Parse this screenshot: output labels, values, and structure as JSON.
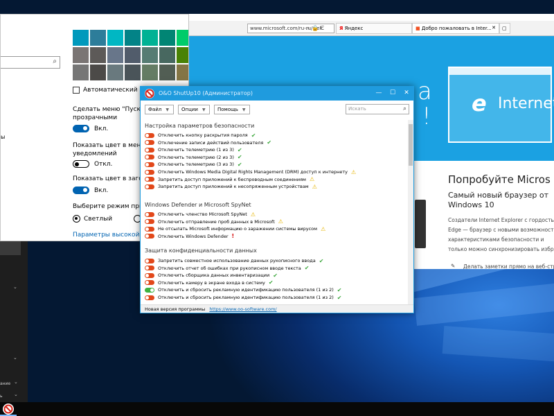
{
  "settings": {
    "auto_color_label": "Автоматический выбо",
    "start_transparent_line1": "Сделать меню \"Пуск\", пан",
    "start_transparent_line2": "прозрачными",
    "toggle1_state": "Вкл.",
    "show_color_start_line1": "Показать цвет в меню \"Пу",
    "show_color_start_line2": "уведомлений",
    "toggle2_state": "Откл.",
    "show_color_title": "Показать цвет в заголовк",
    "toggle3_state": "Вкл.",
    "app_mode_label": "Выберите режим приложе",
    "radio_light": "Светлый",
    "high_contrast_link": "Параметры высокой конт",
    "left_cut_label": "ы",
    "swatches": [
      "#0099bc",
      "#2d7d9a",
      "#00b7c3",
      "#038387",
      "#00b294",
      "#018574",
      "#00cc6a",
      "#10893e",
      "#7a7574",
      "#5d5a58",
      "#68768a",
      "#515c6b",
      "#567c73",
      "#486860",
      "#498205",
      "#107c10",
      "#767676",
      "#4c4a48",
      "#69797e",
      "#4a5459",
      "#647c64",
      "#525e54",
      "#847545",
      "#7e735f"
    ]
  },
  "ie": {
    "address": "www.microsoft.com/ru-ru/welc",
    "tab_yandex": "Яндекс",
    "tab_welcome": "Добро пожаловать в Inter...",
    "hero_char1": "а",
    "hero_char2": "!",
    "brand": "Internet",
    "heading": "Попробуйте Micros",
    "sub1": "Самый новый браузер от",
    "sub2": "Windows 10",
    "p1": "Создатели Internet Explorer с гордостью",
    "p2": "Edge — браузер с новыми возможност",
    "p3": "характеристиками безопасности и",
    "p4": "только можно синхронизировать избра",
    "note": "Делать заметки прямо на веб-стр"
  },
  "start_panel": {
    "text1": "ание",
    "text2": "ь"
  },
  "oo": {
    "title": "O&O ShutUp10 (Администратор)",
    "menu_file": "Файл",
    "menu_options": "Опции",
    "menu_help": "Помощь",
    "search_placeholder": "Искать",
    "status_text": "Новая версия программы",
    "status_link": "https://www.oo-software.com/",
    "groups": [
      {
        "title": "Настройка параметров безопасности"
      },
      {
        "title": "Windows Defender и Microsoft SpyNet"
      },
      {
        "title": "Защита конфиденциальности данных"
      }
    ],
    "options": [
      {
        "label": "Отключить кнопку раскрытия пароля",
        "status": "ok",
        "on": false
      },
      {
        "label": "Отключение записи действий пользователя",
        "status": "ok",
        "on": false
      },
      {
        "label": "Отключить телеметрию (1 из 3)",
        "status": "ok",
        "on": false
      },
      {
        "label": "Отключить телеметрию (2 из 3)",
        "status": "ok",
        "on": false
      },
      {
        "label": "Отключить телеметрию (3 из 3)",
        "status": "ok",
        "on": false
      },
      {
        "label": "Отключить Windows Media Digital Rights Management (DRM) доступ к интернету",
        "status": "warn",
        "on": false
      },
      {
        "label": "Запретить доступ приложений к беспроводным соединениям",
        "status": "warn",
        "on": false
      },
      {
        "label": "Запретить доступ приложений к несопряженным устройствам",
        "status": "warn",
        "on": false
      },
      {
        "label": "Отключить членство Microsoft SpyNet",
        "status": "warn",
        "on": false
      },
      {
        "label": "Отключить отправление проб данных в Microsoft",
        "status": "warn",
        "on": false
      },
      {
        "label": "Не отсылать Microsoft информацию о заражении системы вирусом",
        "status": "warn",
        "on": false
      },
      {
        "label": "Отключить Windows Defender",
        "status": "bad",
        "on": false
      },
      {
        "label": "Запретить совместное использование данных рукописного ввода",
        "status": "ok",
        "on": false
      },
      {
        "label": "Отключить отчет об ошибках при рукописном вводе текста",
        "status": "ok",
        "on": false
      },
      {
        "label": "Отключить сборщика данных инвентаризации",
        "status": "ok",
        "on": false
      },
      {
        "label": "Отключить камеру в экране входа в систему",
        "status": "ok",
        "on": false
      },
      {
        "label": "Отключить и сбросить рекламную идентификацию пользователя (1 из 2)",
        "status": "ok",
        "on": true
      },
      {
        "label": "Отключить и сбросить рекламную идентификацию пользователя (1 из 2)",
        "status": "ok",
        "on": false
      }
    ]
  }
}
